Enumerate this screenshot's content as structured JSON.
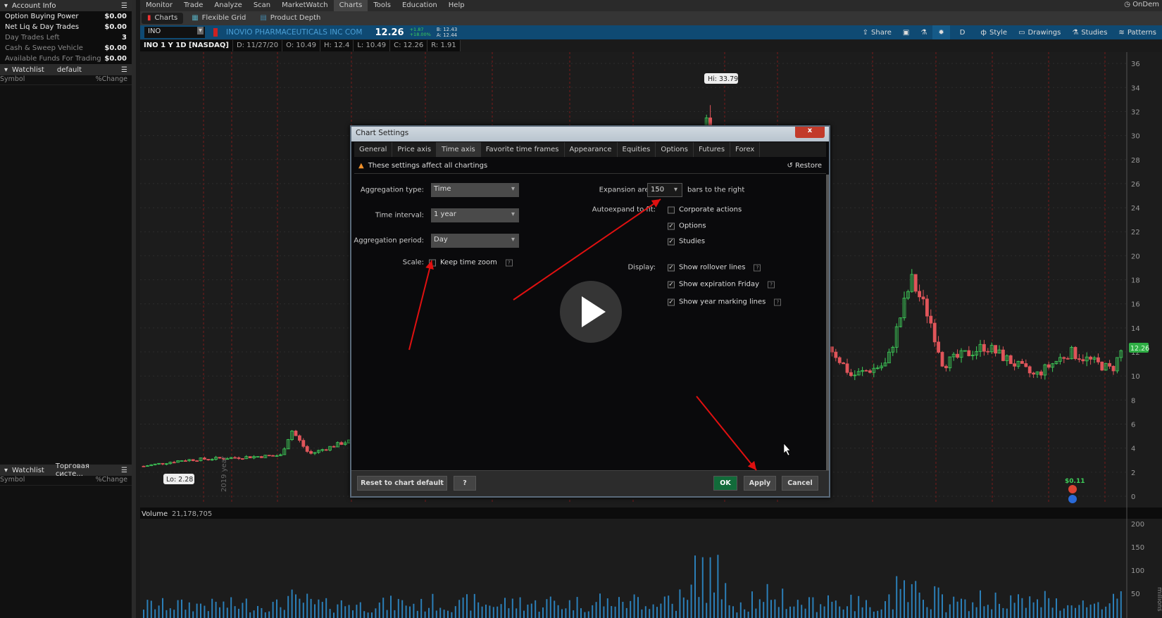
{
  "left": {
    "account_title": "Account Info",
    "account_rows": [
      {
        "label": "Option Buying Power",
        "value": "$0.00",
        "style": "b"
      },
      {
        "label": "Net Liq & Day Trades",
        "value": "$0.00",
        "style": "b"
      },
      {
        "label": "Day Trades Left",
        "value": "3",
        "style": "d"
      },
      {
        "label": "Cash & Sweep Vehicle",
        "value": "$0.00",
        "style": "d"
      },
      {
        "label": "Available Funds For Trading",
        "value": "$0.00",
        "style": "d"
      }
    ],
    "watchlist1": {
      "title": "Watchlist",
      "name": "default",
      "col_symbol": "Symbol",
      "col_change": "%Change"
    },
    "watchlist2": {
      "title": "Watchlist",
      "name": "Торговая систе...",
      "col_symbol": "Symbol",
      "col_change": "%Change"
    }
  },
  "menu": [
    "Monitor",
    "Trade",
    "Analyze",
    "Scan",
    "MarketWatch",
    "Charts",
    "Tools",
    "Education",
    "Help"
  ],
  "menu_active": "Charts",
  "ondemand": "OnDem",
  "subtabs": [
    "Charts",
    "Flexible Grid",
    "Product Depth"
  ],
  "symbar": {
    "symbol": "INO",
    "company": "INOVIO PHARMACEUTICALS INC COM",
    "last": "12.26",
    "change": "+1.87",
    "change_pct": "+18.00%",
    "bid": "B: 12.43",
    "ask": "A: 12.44",
    "tools": [
      "Share",
      "D",
      "Style",
      "Drawings",
      "Studies",
      "Patterns"
    ]
  },
  "info": {
    "title": "INO 1 Y 1D [NASDAQ]",
    "d": "D: 11/27/20",
    "o": "O: 10.49",
    "h": "H: 12.4",
    "l": "L: 10.49",
    "c": "C: 12.26",
    "r": "R: 1.91"
  },
  "chart": {
    "hi_label": "Hi: 33.79",
    "lo_label": "Lo: 2.28",
    "price_ticks": [
      "36",
      "34",
      "32",
      "30",
      "28",
      "26",
      "24",
      "22",
      "20",
      "18",
      "16",
      "14",
      "12",
      "10",
      "8",
      "6",
      "4",
      "2",
      "0"
    ],
    "last_badge": "12.26",
    "dividend": "$0.11",
    "year_label": "2019 year",
    "volume_label": "Volume",
    "volume_value": "21,178,705",
    "volume_ticks": [
      "200",
      "150",
      "100",
      "50"
    ],
    "volume_unit": "millions",
    "colors": {
      "up": "#3ecf5a",
      "down": "#e0555a",
      "volume": "#2b7fb8",
      "year_line": "#8a1a1a"
    }
  },
  "dialog": {
    "title": "Chart Settings",
    "close": "x",
    "tabs": [
      "General",
      "Price axis",
      "Time axis",
      "Favorite time frames",
      "Appearance",
      "Equities",
      "Options",
      "Futures",
      "Forex"
    ],
    "active_tab": "Time axis",
    "warning": "These settings affect all chartings",
    "restore": "Restore",
    "aggregation_type_label": "Aggregation type:",
    "aggregation_type": "Time",
    "time_interval_label": "Time interval:",
    "time_interval": "1 year",
    "aggregation_period_label": "Aggregation period:",
    "aggregation_period": "Day",
    "scale_label": "Scale:",
    "keep_time_zoom": "Keep time zoom",
    "keep_time_zoom_checked": false,
    "expansion_label": "Expansion area:",
    "expansion_value": "150",
    "expansion_suffix": "bars to the right",
    "autoexpand_label": "Autoexpand to fit:",
    "autoexpand": [
      {
        "label": "Corporate actions",
        "checked": false
      },
      {
        "label": "Options",
        "checked": true
      },
      {
        "label": "Studies",
        "checked": true
      }
    ],
    "display_label": "Display:",
    "display": [
      {
        "label": "Show rollover lines",
        "checked": true
      },
      {
        "label": "Show expiration Friday",
        "checked": true
      },
      {
        "label": "Show year marking lines",
        "checked": true
      }
    ],
    "reset": "Reset to chart default",
    "help": "?",
    "ok": "OK",
    "apply": "Apply",
    "cancel": "Cancel"
  }
}
